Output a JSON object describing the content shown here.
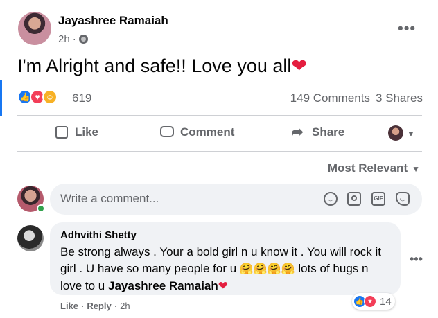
{
  "post": {
    "author": "Jayashree Ramaiah",
    "time": "2h",
    "dot": "·",
    "more": "•••",
    "text": "I'm Alright and safe!! Love you all",
    "heart": "❤"
  },
  "reactions": {
    "icons": [
      "like-icon",
      "love-icon",
      "care-icon"
    ],
    "count": "619",
    "comments": "149 Comments",
    "shares": "3 Shares"
  },
  "actions": {
    "like": "Like",
    "comment": "Comment",
    "share": "Share"
  },
  "sort": {
    "label": "Most Relevant"
  },
  "composer": {
    "placeholder": "Write a comment..."
  },
  "comment": {
    "author": "Adhvithi Shetty",
    "text_part1": "Be strong always . Your a bold girl n u know it . You will rock it girl . U have so many people for u ",
    "hugs": "🤗🤗🤗🤗",
    "text_part2": " lots of hugs n love to u ",
    "mention": "Jayashree Ramaiah",
    "heart": "❤",
    "reaction_count": "14",
    "like": "Like",
    "reply": "Reply",
    "time": "2h",
    "sep": "·"
  },
  "colors": {
    "accent": "#1877f2",
    "love": "#f33e58",
    "secondary_text": "#65676b",
    "bubble": "#f0f2f5"
  }
}
